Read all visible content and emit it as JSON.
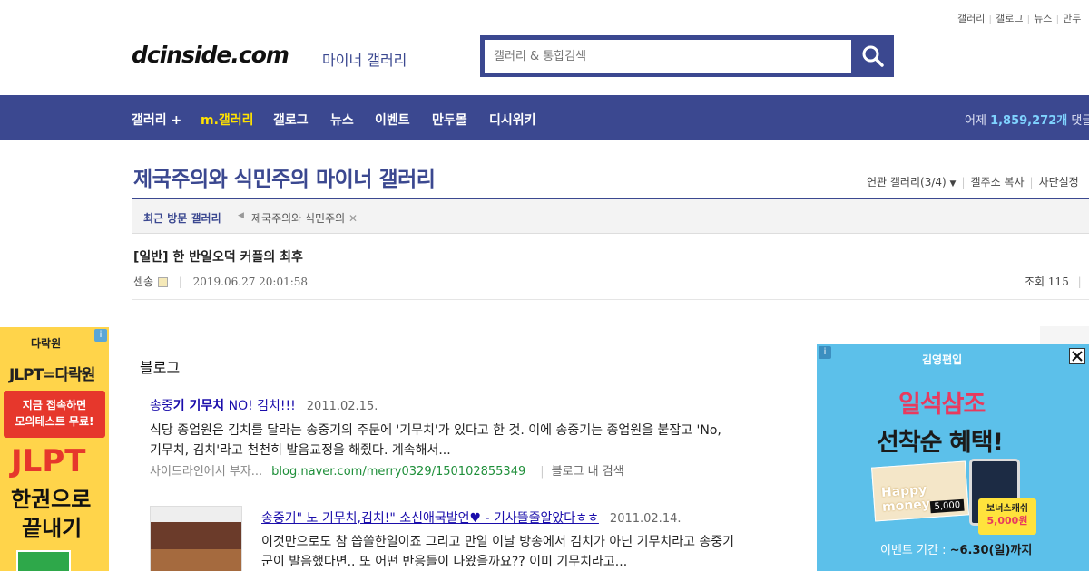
{
  "util_links": [
    "갤러리",
    "갤로그",
    "뉴스",
    "만두"
  ],
  "logo": {
    "main": "dcinside.com",
    "sub": "마이너 갤러리"
  },
  "search": {
    "placeholder": "갤러리 & 통합검색"
  },
  "nav": {
    "items": [
      "갤러리 +",
      "m.갤러리",
      "갤로그",
      "뉴스",
      "이벤트",
      "만두몰",
      "디시위키"
    ],
    "stat_label": "어제",
    "stat_value": "1,859,272개",
    "stat_suffix": "댓글"
  },
  "gallery": {
    "title": "제국주의와 식민주의 마이너 갤러리",
    "tools": [
      "연관 갤러리(3/4)",
      "갤주소 복사",
      "차단설정"
    ]
  },
  "recent": {
    "label": "최근 방문 갤러리",
    "item": "제국주의와 식민주의"
  },
  "post": {
    "title": "[일반] 한 반일오덕 커플의 최후",
    "author": "센송",
    "date": "2019.06.27 20:01:58",
    "views_label": "조회",
    "views": "115"
  },
  "content": {
    "section_label": "블로그",
    "results": [
      {
        "title_pre": "송중",
        "title_b1": "기 기무치",
        "title_post": " NO! 김치!!!",
        "date": "2011.02.15.",
        "line1": "식당 종업원은 김치를 달라는 송중기의 주문에 '기무치'가 있다고 한 것. 이에 송중기는 종업원을 붙잡고 'No,",
        "line2": "기무치, 김치'라고 천천히 발음교정을 해줬다. 계속해서...",
        "source": "사이드라인에서 부자...",
        "url": "blog.naver.com/merry0329/150102855349",
        "extra": "블로그 내 검색"
      },
      {
        "title": "송중기\" 노 기무치,김치!\" 소신애국발언♥ - 기사뜰줄알았다ㅎㅎ",
        "date": "2011.02.14.",
        "line1": "이것만으로도 참 씁쓸한일이죠 그리고 만일 이날 방송에서 김치가 아닌 기무치라고 송중기",
        "line2": "군이 발음했다면.. 또 어떤 반응들이 나왔을까요?? 이미 기무치라고..."
      }
    ]
  },
  "left_ad": {
    "brand": "다락원",
    "headline": "JLPT=다락원",
    "red_line1": "지금 접속하면",
    "red_line2": "모의테스트 무료!",
    "big": "JLPT",
    "l1": "한권으로",
    "l2": "끝내기"
  },
  "right_ad": {
    "brand": "김영편입",
    "t1": "일석삼조",
    "t2": "선착순 혜택!",
    "card_text": "Happy money",
    "card_value": "5,000",
    "bonus_l1": "보너스캐쉬",
    "bonus_l2": "5,000원",
    "period_label": "이벤트 기간 :",
    "period_value": "~6.30(일)까지"
  }
}
